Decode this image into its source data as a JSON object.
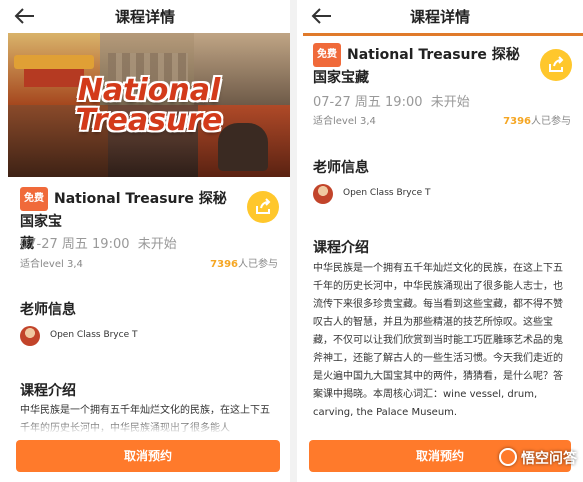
{
  "header": {
    "title": "课程详情"
  },
  "banner": {
    "line1": "National",
    "line2": "Treasure"
  },
  "course": {
    "badge": "免费",
    "title": "National Treasure 探秘国家宝藏",
    "title_left_line1": "National Treasure 探秘国家宝",
    "title_left_line2": "藏",
    "time": "07-27 周五 19:00",
    "status": "未开始",
    "level": "适合level 3,4",
    "participants": "7396",
    "participants_suffix": "人已参与"
  },
  "teacher": {
    "section_title": "老师信息",
    "name": "Open Class Bryce T"
  },
  "intro": {
    "section_title": "课程介绍",
    "left_visible": "中华民族是一个拥有五千年灿烂文化的民族，在这上下五千年的历史长河中，中华民族涌现出了很多能人",
    "full_text": "中华民族是一个拥有五千年灿烂文化的民族，在这上下五千年的历史长河中，中华民族涌现出了很多能人志士，也流传下来很多珍贵宝藏。每当看到这些宝藏，都不得不赞叹古人的智慧，并且为那些精湛的技艺所惊叹。这些宝藏，不仅可以让我们欣赏到当时能工巧匠雕琢艺术品的鬼斧神工，还能了解古人的一些生活习惯。今天我们走近的是火遍中国九大国宝其中的两件，猜猜看，是什么呢？答案课中揭晓。本周核心词汇：wine vessel, drum, carving, the Palace Museum."
  },
  "actions": {
    "cancel_label": "取消预约"
  },
  "watermark": {
    "text": "悟空问答"
  }
}
